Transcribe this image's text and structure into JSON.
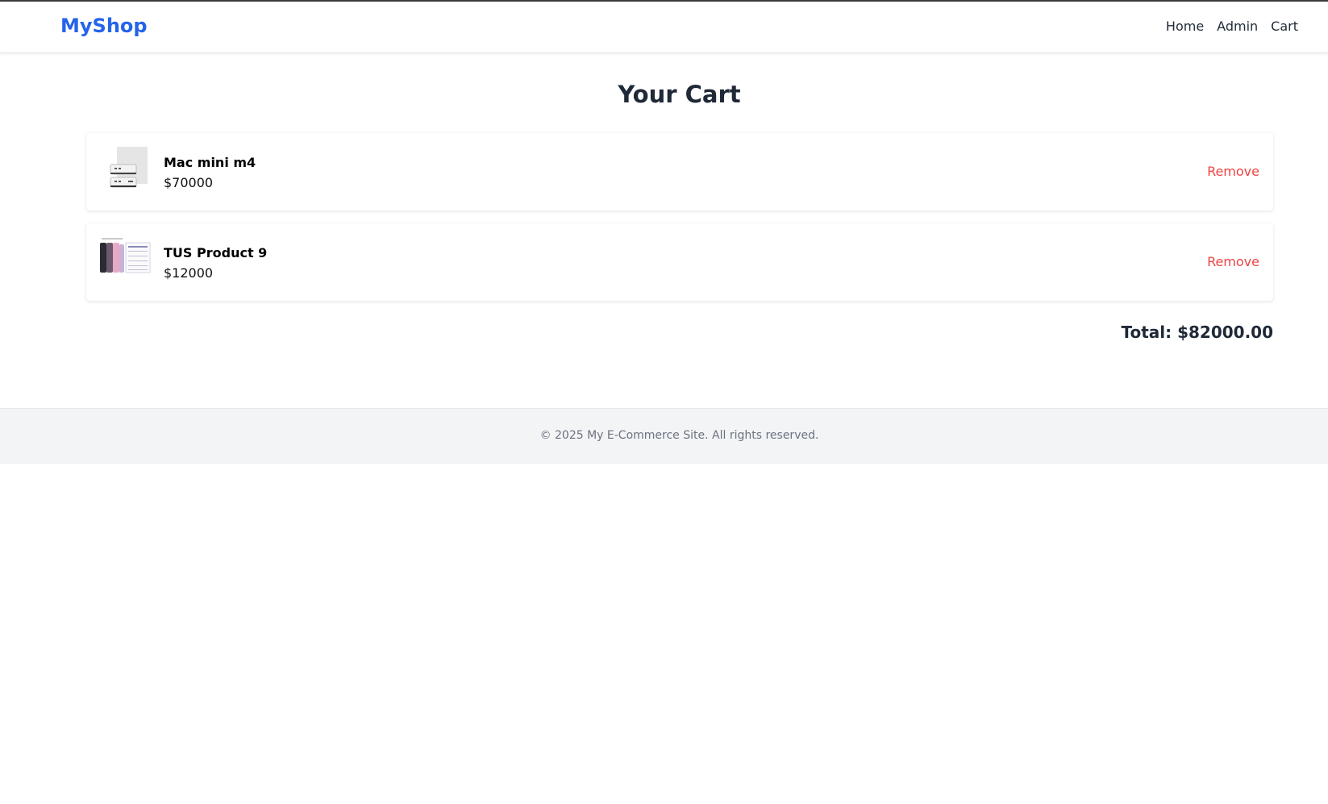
{
  "header": {
    "logo": "MyShop",
    "nav": [
      "Home",
      "Admin",
      "Cart"
    ]
  },
  "page": {
    "title": "Your Cart"
  },
  "cart": {
    "items": [
      {
        "name": "Mac mini m4",
        "price": "$70000",
        "remove_label": "Remove",
        "image": "mac-mini-image"
      },
      {
        "name": "TUS Product 9",
        "price": "$12000",
        "remove_label": "Remove",
        "image": "phone-product-image"
      }
    ],
    "total": "Total: $82000.00"
  },
  "footer": {
    "text": "© 2025 My E-Commerce Site. All rights reserved."
  },
  "colors": {
    "brand": "#2563eb",
    "danger": "#ef4444",
    "footer_bg": "#f3f4f6"
  }
}
